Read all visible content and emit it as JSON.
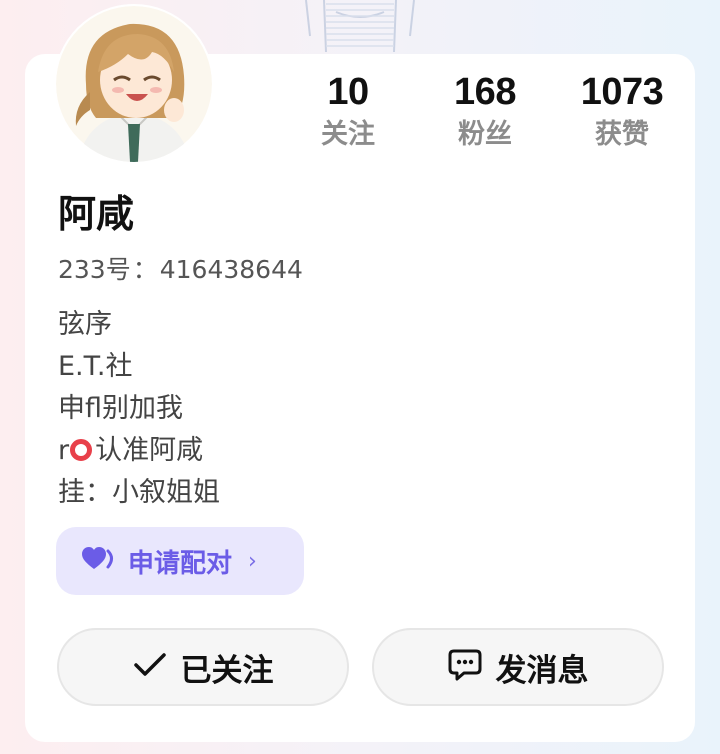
{
  "profile": {
    "username": "阿咸",
    "id_label": "233号",
    "id_separator": "：",
    "id_value": "416438644",
    "avatar_icon": "anime-girl-avatar"
  },
  "stats": {
    "following": {
      "value": "10",
      "label": "关注"
    },
    "followers": {
      "value": "168",
      "label": "粉丝"
    },
    "likes": {
      "value": "1073",
      "label": "获赞"
    }
  },
  "bio": {
    "line1": "弦序",
    "line2": "E.T.社",
    "line3": "申fl别加我",
    "line4_prefix": "r",
    "line4_icon": "red-ring-emoji",
    "line4_suffix": "认准阿咸",
    "line5": "挂：小叙姐姐"
  },
  "pair_button": {
    "label": "申请配对",
    "icon": "heart-pair-icon",
    "chevron": "›",
    "color": "#6b5ce7",
    "background": "#e9e7fd"
  },
  "actions": {
    "follow_label": "已关注",
    "follow_icon": "check-icon",
    "message_label": "发消息",
    "message_icon": "chat-bubble-icon"
  },
  "colors": {
    "card": "#ffffff",
    "muted_text": "#8c8c8c",
    "accent": "#6b5ce7"
  }
}
